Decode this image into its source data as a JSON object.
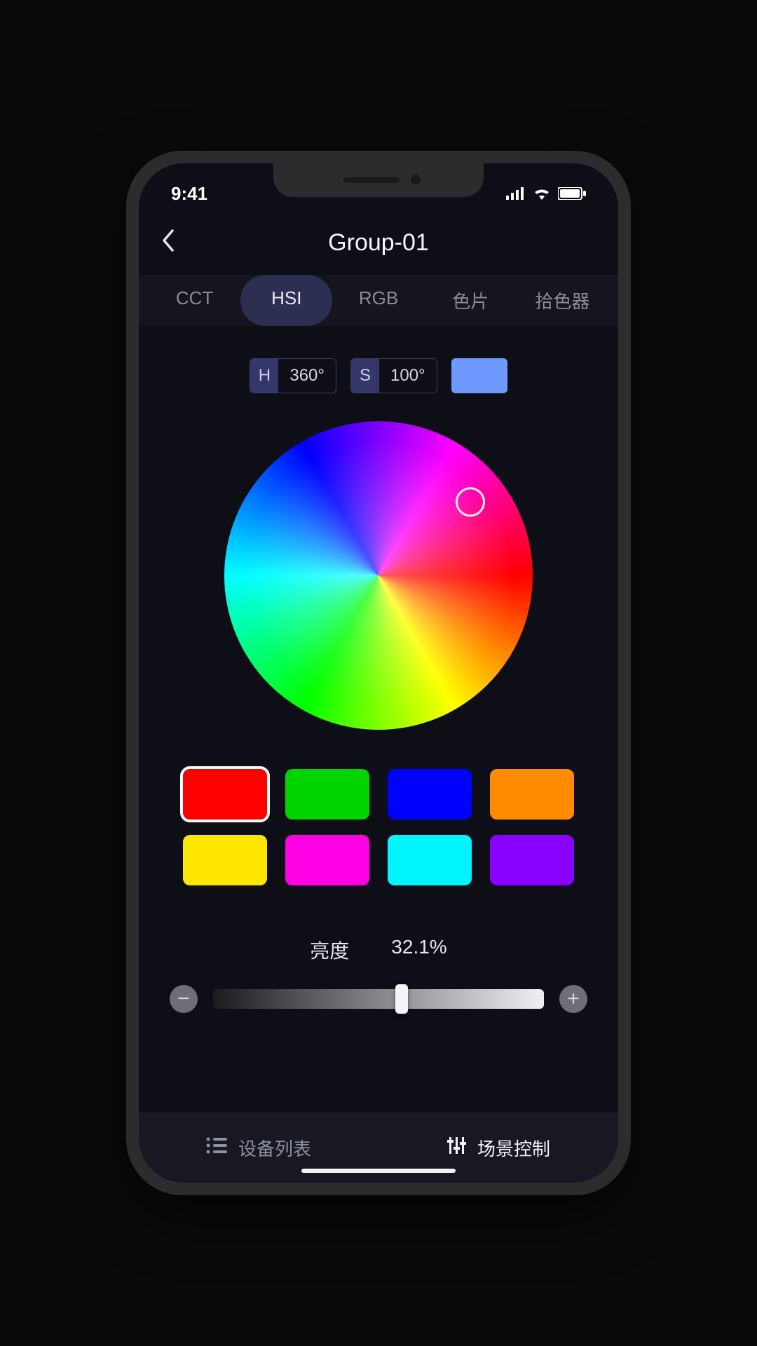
{
  "status": {
    "time": "9:41"
  },
  "header": {
    "title": "Group-01"
  },
  "tabs": [
    {
      "label": "CCT",
      "active": false
    },
    {
      "label": "HSI",
      "active": true
    },
    {
      "label": "RGB",
      "active": false
    },
    {
      "label": "色片",
      "active": false
    },
    {
      "label": "拾色器",
      "active": false
    }
  ],
  "hsi": {
    "hue_label": "H",
    "hue_value": "360°",
    "sat_label": "S",
    "sat_value": "100°",
    "preview_color": "#6e9aff"
  },
  "presets": [
    {
      "color": "#ff0000",
      "selected": true
    },
    {
      "color": "#00d400",
      "selected": false
    },
    {
      "color": "#0000ff",
      "selected": false
    },
    {
      "color": "#ff8c00",
      "selected": false
    },
    {
      "color": "#ffe600",
      "selected": false
    },
    {
      "color": "#ff00e5",
      "selected": false
    },
    {
      "color": "#00f5ff",
      "selected": false
    },
    {
      "color": "#8a00ff",
      "selected": false
    }
  ],
  "brightness": {
    "label": "亮度",
    "value_text": "32.1%",
    "value_pct": 55
  },
  "bottom_nav": {
    "device_list": "设备列表",
    "scene_control": "场景控制"
  }
}
